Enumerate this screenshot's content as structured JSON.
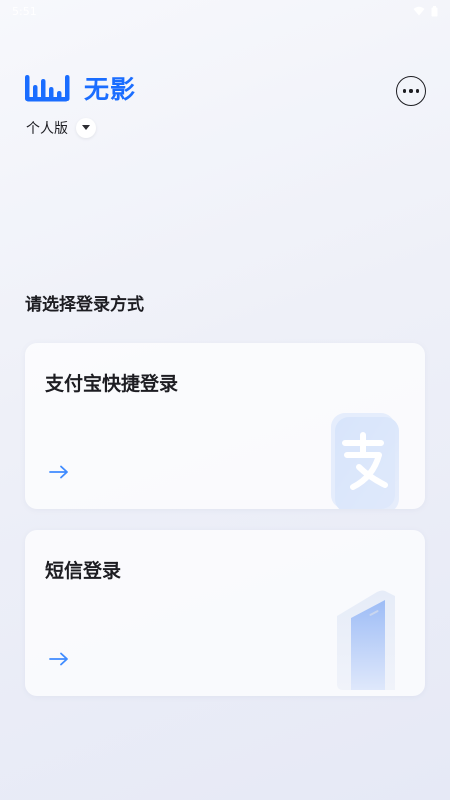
{
  "status_bar": {
    "time": "5:51"
  },
  "brand": {
    "name": "无影"
  },
  "edition": {
    "label": "个人版"
  },
  "page": {
    "section_title": "请选择登录方式"
  },
  "login_options": [
    {
      "label": "支付宝快捷登录",
      "icon": "alipay-icon"
    },
    {
      "label": "短信登录",
      "icon": "phone-icon"
    }
  ],
  "colors": {
    "accent": "#1a6dff",
    "text": "#1d1d22",
    "card": "#ffffff"
  }
}
